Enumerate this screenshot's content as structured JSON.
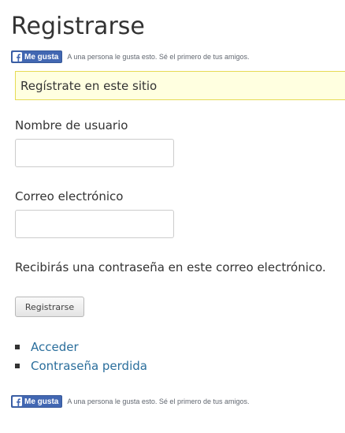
{
  "page": {
    "title": "Registrarse"
  },
  "facebook": {
    "like_label": "Me gusta",
    "social_text": "A una persona le gusta esto. Sé el primero de tus amigos.",
    "brand_color": "#4267b2"
  },
  "notice": {
    "text": "Regístrate en este sitio",
    "background": "#ffffe0",
    "border_color": "#e6db55"
  },
  "form": {
    "username_label": "Nombre de usuario",
    "username_value": "",
    "email_label": "Correo electrónico",
    "email_value": "",
    "info_text": "Recibirás una contraseña en este correo electrónico.",
    "submit_label": "Registrarse"
  },
  "links": [
    {
      "label": "Acceder"
    },
    {
      "label": "Contraseña perdida"
    }
  ],
  "colors": {
    "link": "#2a6e9c",
    "text": "#333333"
  }
}
